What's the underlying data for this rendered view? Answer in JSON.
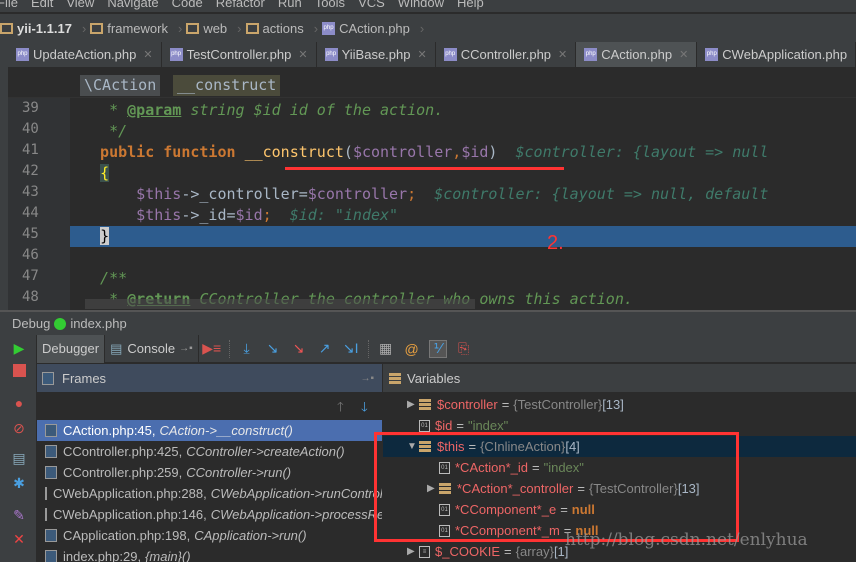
{
  "menu": [
    "File",
    "Edit",
    "View",
    "Navigate",
    "Code",
    "Refactor",
    "Run",
    "Tools",
    "VCS",
    "Window",
    "Help"
  ],
  "breadcrumb": [
    "yii-1.1.17",
    "framework",
    "web",
    "actions",
    "CAction.php"
  ],
  "tabs": [
    {
      "label": "UpdateAction.php"
    },
    {
      "label": "TestController.php"
    },
    {
      "label": "YiiBase.php"
    },
    {
      "label": "CController.php"
    },
    {
      "label": "CAction.php",
      "active": true
    },
    {
      "label": "CWebApplication.php"
    }
  ],
  "context": {
    "class": "\\CAction",
    "method": "__construct"
  },
  "code": {
    "line_numbers": [
      "39",
      "40",
      "41",
      "42",
      "43",
      "44",
      "45",
      "46",
      "47",
      "48"
    ],
    "lines": [
      [
        [
          "doc",
          "   * "
        ],
        [
          "tag",
          "@param"
        ],
        [
          "doc",
          " string $id id of the action."
        ]
      ],
      [
        [
          "doc",
          "   */"
        ]
      ],
      [
        [
          "kw",
          "  public function "
        ],
        [
          "fn",
          "__construct"
        ],
        [
          "pl",
          "("
        ],
        [
          "var",
          "$controller"
        ],
        [
          "semi",
          ","
        ],
        [
          "var",
          "$id"
        ],
        [
          "pl",
          ")"
        ],
        [
          "hint",
          "  $controller: {layout => null"
        ]
      ],
      [
        [
          "pl",
          "  "
        ],
        [
          "brace",
          "{"
        ]
      ],
      [
        [
          "var",
          "      $this"
        ],
        [
          "pl",
          "->_controller="
        ],
        [
          "var",
          "$controller"
        ],
        [
          "semi",
          ";"
        ],
        [
          "hint",
          "  $controller: {layout => null, default"
        ]
      ],
      [
        [
          "var",
          "      $this"
        ],
        [
          "pl",
          "->_id="
        ],
        [
          "var",
          "$id"
        ],
        [
          "semi",
          ";"
        ],
        [
          "hint",
          "  $id: \"index\""
        ]
      ],
      [
        [
          "pl",
          "  "
        ],
        [
          "brace2",
          "}"
        ]
      ],
      [
        [
          "pl",
          ""
        ]
      ],
      [
        [
          "doc",
          "  /**"
        ]
      ],
      [
        [
          "doc",
          "   * "
        ],
        [
          "tag",
          "@return"
        ],
        [
          "doc",
          " CController the controller who owns this action."
        ]
      ]
    ],
    "current_line_index": 6
  },
  "annotation": "2.",
  "debug": {
    "title": "Debug",
    "config": "index.php",
    "tabs": [
      "Debugger",
      "Console"
    ]
  },
  "frames": {
    "title": "Frames",
    "items": [
      {
        "file": "CAction.php:45,",
        "call": "CAction->__construct()",
        "selected": true
      },
      {
        "file": "CController.php:425,",
        "call": "CController->createAction()"
      },
      {
        "file": "CController.php:259,",
        "call": "CController->run()"
      },
      {
        "file": "CWebApplication.php:288,",
        "call": "CWebApplication->runController()"
      },
      {
        "file": "CWebApplication.php:146,",
        "call": "CWebApplication->processRequest()"
      },
      {
        "file": "CApplication.php:198,",
        "call": "CApplication->run()"
      },
      {
        "file": "index.php:29,",
        "call": "{main}()"
      }
    ]
  },
  "variables": {
    "title": "Variables",
    "items": [
      {
        "name": "$controller",
        "type": "{TestController}",
        "value": "[13]",
        "kind": "object",
        "arrow": "▶",
        "indent": 0
      },
      {
        "name": "$id",
        "value": "\"index\"",
        "kind": "string",
        "arrow": "",
        "indent": 0
      },
      {
        "name": "$this",
        "type": "{CInlineAction}",
        "value": "[4]",
        "kind": "object",
        "arrow": "▼",
        "indent": 0,
        "selected": true
      },
      {
        "name": "*CAction*_id",
        "value": "\"index\"",
        "kind": "string",
        "arrow": "",
        "indent": 1
      },
      {
        "name": "*CAction*_controller",
        "type": "{TestController}",
        "value": "[13]",
        "kind": "object",
        "arrow": "▶",
        "indent": 1
      },
      {
        "name": "*CComponent*_e",
        "value": "null",
        "kind": "null",
        "arrow": "",
        "indent": 1
      },
      {
        "name": "*CComponent*_m",
        "value": "null",
        "kind": "null",
        "arrow": "",
        "indent": 1
      },
      {
        "name": "$_COOKIE",
        "type": "{array}",
        "value": "[1]",
        "kind": "array",
        "arrow": "▶",
        "indent": 0
      }
    ]
  },
  "watermark": "http://blog.csdn.net/enlyhua",
  "colors": {
    "highlight": "#2d5c8e",
    "annotation": "#ff3333",
    "selected_frame": "#4b6eaf"
  }
}
